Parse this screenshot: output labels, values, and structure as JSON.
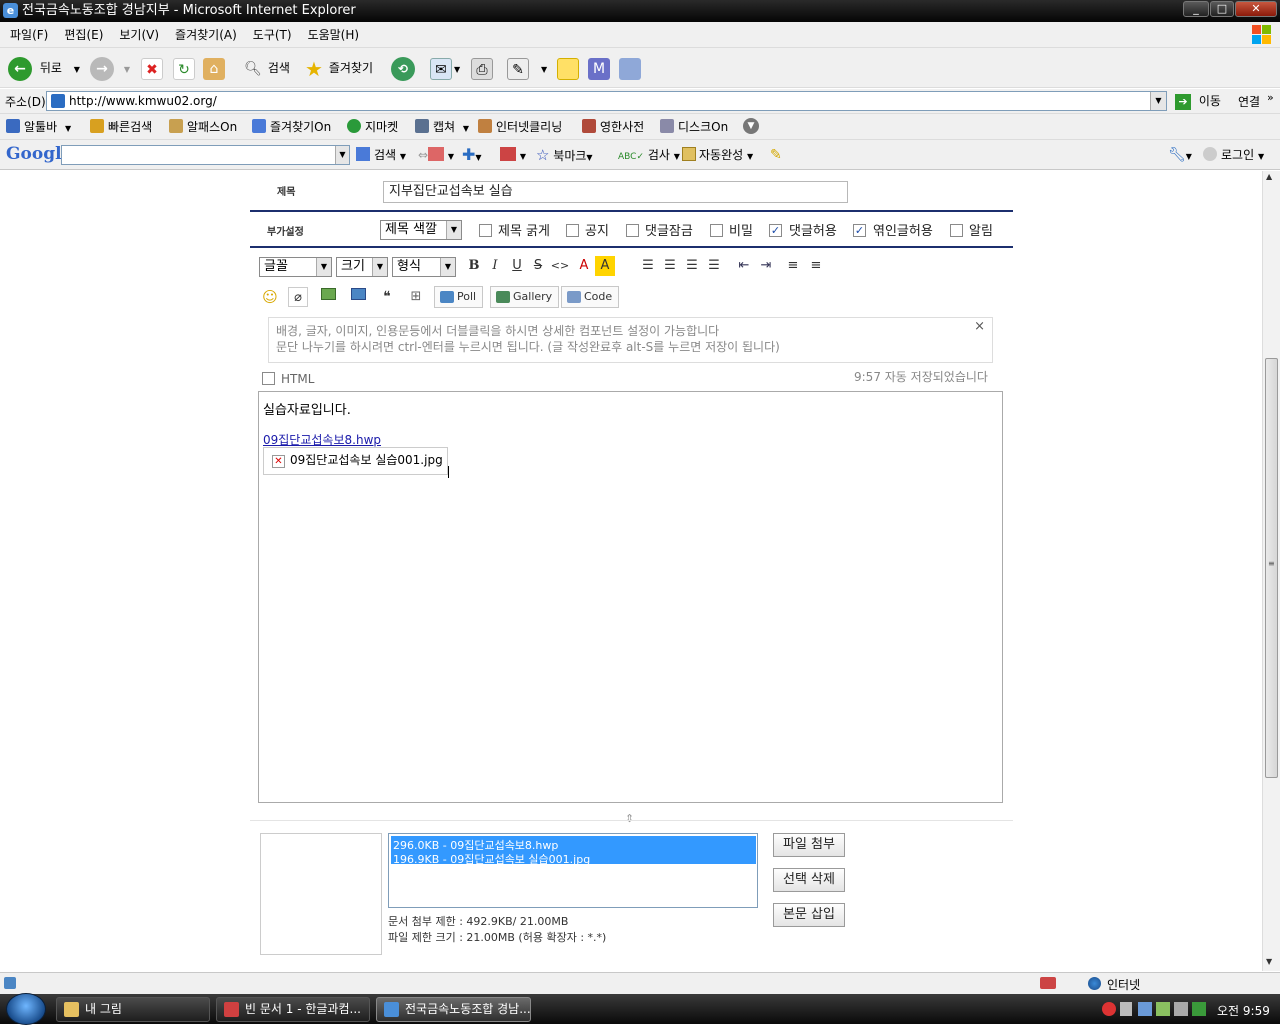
{
  "window": {
    "title": "전국금속노동조합 경남지부 - Microsoft Internet Explorer",
    "minimize": "_",
    "maximize": "□",
    "close": "✕"
  },
  "menu": [
    "파일(F)",
    "편집(E)",
    "보기(V)",
    "즐겨찾기(A)",
    "도구(T)",
    "도움말(H)"
  ],
  "toolbar": {
    "back": "뒤로",
    "search": "검색",
    "favorites": "즐겨찾기"
  },
  "address": {
    "label": "주소(D)",
    "url": "http://www.kmwu02.org/",
    "go": "이동",
    "links": "연결"
  },
  "links_bar": [
    "알툴바",
    "빠른검색",
    "알패스On",
    "즐겨찾기On",
    "지마켓",
    "캡쳐",
    "인터넷클리닝",
    "영한사전",
    "디스크On"
  ],
  "google_bar": {
    "logo": "Google",
    "search": "검색",
    "bookmarks": "북마크",
    "check": "검사",
    "autofill": "자동완성",
    "login": "로그인"
  },
  "form": {
    "subject_label": "제목",
    "subject_value": "지부집단교섭속보 실습",
    "options_label": "부가설정",
    "title_color": "제목 색깔",
    "options": [
      {
        "label": "제목 굵게",
        "checked": false
      },
      {
        "label": "공지",
        "checked": false
      },
      {
        "label": "댓글잠금",
        "checked": false
      },
      {
        "label": "비밀",
        "checked": false
      },
      {
        "label": "댓글허용",
        "checked": true
      },
      {
        "label": "엮인글허용",
        "checked": true
      },
      {
        "label": "알림",
        "checked": false
      }
    ]
  },
  "editor": {
    "font": "글꼴",
    "size": "크기",
    "format": "형식",
    "bold": "B",
    "italic": "I",
    "underline": "U",
    "strike": "S",
    "code_tag": "<>",
    "font_color": "A",
    "bg_color": "A",
    "poll": "Poll",
    "gallery": "Gallery",
    "code": "Code",
    "tip_line1": "배경, 글자, 이미지, 인용문등에서 더블클릭을 하시면 상세한 컴포넌트 설정이 가능합니다",
    "tip_line2": "문단 나누기를 하시려면 ctrl-엔터를 누르시면 됩니다. (글 작성완료후 alt-S를 누르면 저장이 됩니다)",
    "tip_close": "×",
    "html_label": "HTML",
    "autosave": "9:57 자동 저장되었습니다",
    "body_text": "실습자료입니다.",
    "body_link": "09집단교섭속보8.hwp",
    "body_image_alt": "09집단교섭속보 실습001.jpg"
  },
  "attach": {
    "files": [
      "296.0KB - 09집단교섭속보8.hwp",
      "196.9KB - 09집단교섭속보 실습001.jpg"
    ],
    "limit_doc": "문서 첨부 제한 : 492.9KB/ 21.00MB",
    "limit_file": "파일 제한 크기 : 21.00MB (허용 확장자 : *.*)",
    "btn_attach": "파일 첨부",
    "btn_delete": "선택 삭제",
    "btn_insert": "본문 삽입"
  },
  "status": {
    "zone": "인터넷"
  },
  "taskbar": {
    "tasks": [
      "내 그림",
      "빈 문서 1 - 한글과컴...",
      "전국금속노동조합 경남..."
    ],
    "clock": "오전 9:59"
  }
}
